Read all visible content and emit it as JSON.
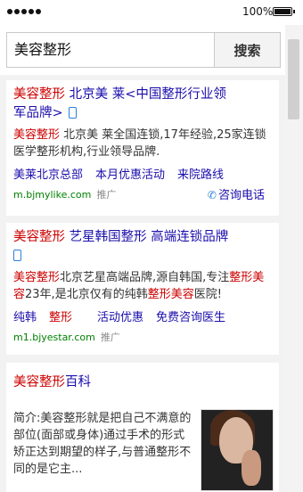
{
  "status_bar": {
    "battery_percent": "100%",
    "signal_dots": 5
  },
  "search": {
    "query": "美容整形",
    "button_label": "搜索"
  },
  "results": [
    {
      "title_hl": "美容整形",
      "title_rest_line1": " 北京美 莱<中国整形行业领",
      "title_rest_line2": "军品牌>",
      "desc_hl": "美容整形",
      "desc_rest": " 北京美 莱全国连锁,17年经验,25家连锁医学整形机构,行业领导品牌.",
      "links": [
        "美莱北京总部",
        "本月优惠活动",
        "来院路线"
      ],
      "call_label": "咨询电话",
      "url": "m.bjmylike.com",
      "ad_label": "推广"
    },
    {
      "title_hl": "美容整形",
      "title_rest": " 艺星韩国整形 高端连锁品牌",
      "desc_parts": [
        "美容整形",
        "北京艺星高端品牌,源自韩国,专注",
        "整形美容",
        "23年,是北京仅有的纯韩",
        "整形美容",
        "医院!"
      ],
      "links": [
        "纯韩",
        "整形",
        "活动优惠",
        "免费咨询医生"
      ],
      "url": "m1.bjyestar.com",
      "ad_label": "推广"
    },
    {
      "title_hl": "美容整形",
      "title_rest": "百科",
      "desc": "简介:美容整形就是把自己不满意的部位(面部或身体)通过手术的形式矫正达到期望的样子,与普通整形不同的是它主..."
    }
  ]
}
